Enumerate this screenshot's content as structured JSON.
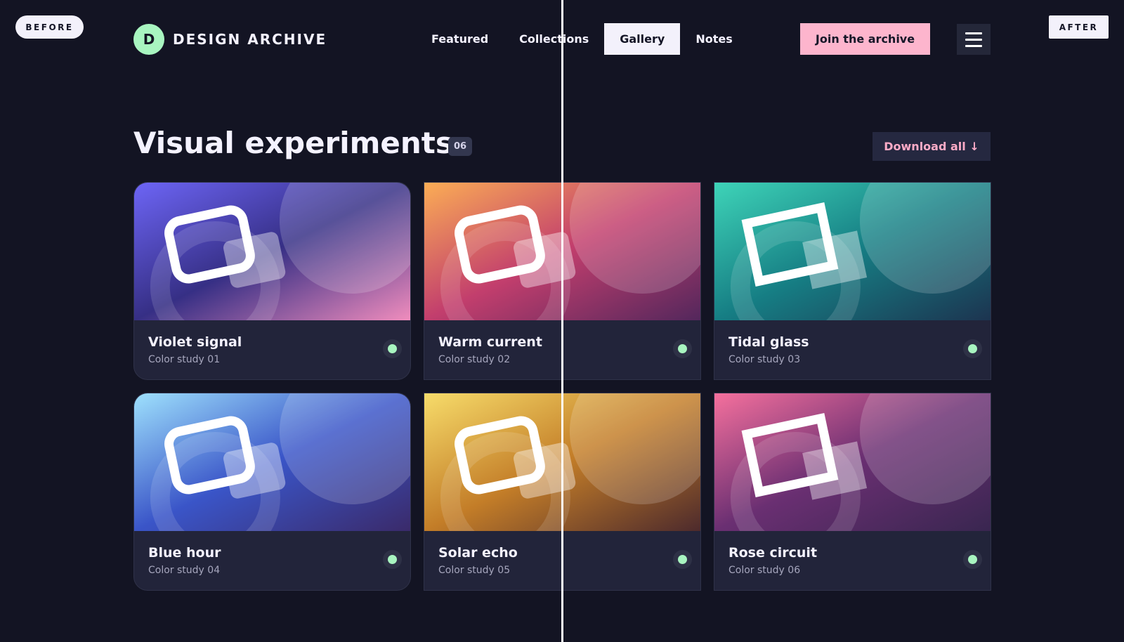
{
  "compare": {
    "before_label": "BEFORE",
    "after_label": "AFTER"
  },
  "brand": {
    "mark": "D",
    "name": "DESIGN ARCHIVE"
  },
  "nav": {
    "items": [
      {
        "label": "Featured",
        "active": false
      },
      {
        "label": "Collections",
        "active": false
      },
      {
        "label": "Gallery",
        "active": true
      },
      {
        "label": "Notes",
        "active": false
      }
    ],
    "cta_label": "Join the archive",
    "menu_icon": "hamburger-menu-icon"
  },
  "section": {
    "title": "Visual experiments",
    "count": "06",
    "download_label": "Download all ↓"
  },
  "cards": [
    {
      "title": "Violet signal",
      "subtitle": "Color study 01",
      "colors": [
        "#6d65f6",
        "#362f85",
        "#f08dbd"
      ],
      "status_color": "#a8f5c0"
    },
    {
      "title": "Warm current",
      "subtitle": "Color study 02",
      "colors": [
        "#fbad55",
        "#c23e6d",
        "#53275c"
      ],
      "status_color": "#a8f5c0"
    },
    {
      "title": "Tidal glass",
      "subtitle": "Color study 03",
      "colors": [
        "#3ed4b8",
        "#167e84",
        "#1c3450"
      ],
      "status_color": "#a8f5c0"
    },
    {
      "title": "Blue hour",
      "subtitle": "Color study 04",
      "colors": [
        "#9ee1fd",
        "#3a55c8",
        "#3a2a6a"
      ],
      "status_color": "#a8f5c0"
    },
    {
      "title": "Solar echo",
      "subtitle": "Color study 05",
      "colors": [
        "#f7dc6a",
        "#c37d28",
        "#4d2a2c"
      ],
      "status_color": "#a8f5c0"
    },
    {
      "title": "Rose circuit",
      "subtitle": "Color study 06",
      "colors": [
        "#f5709d",
        "#6a2f72",
        "#392650"
      ],
      "status_color": "#a8f5c0"
    }
  ],
  "colors": {
    "background": "#131423",
    "accent_green": "#a8f5c0",
    "accent_pink": "#fdb5cd",
    "card": "#22243a"
  }
}
